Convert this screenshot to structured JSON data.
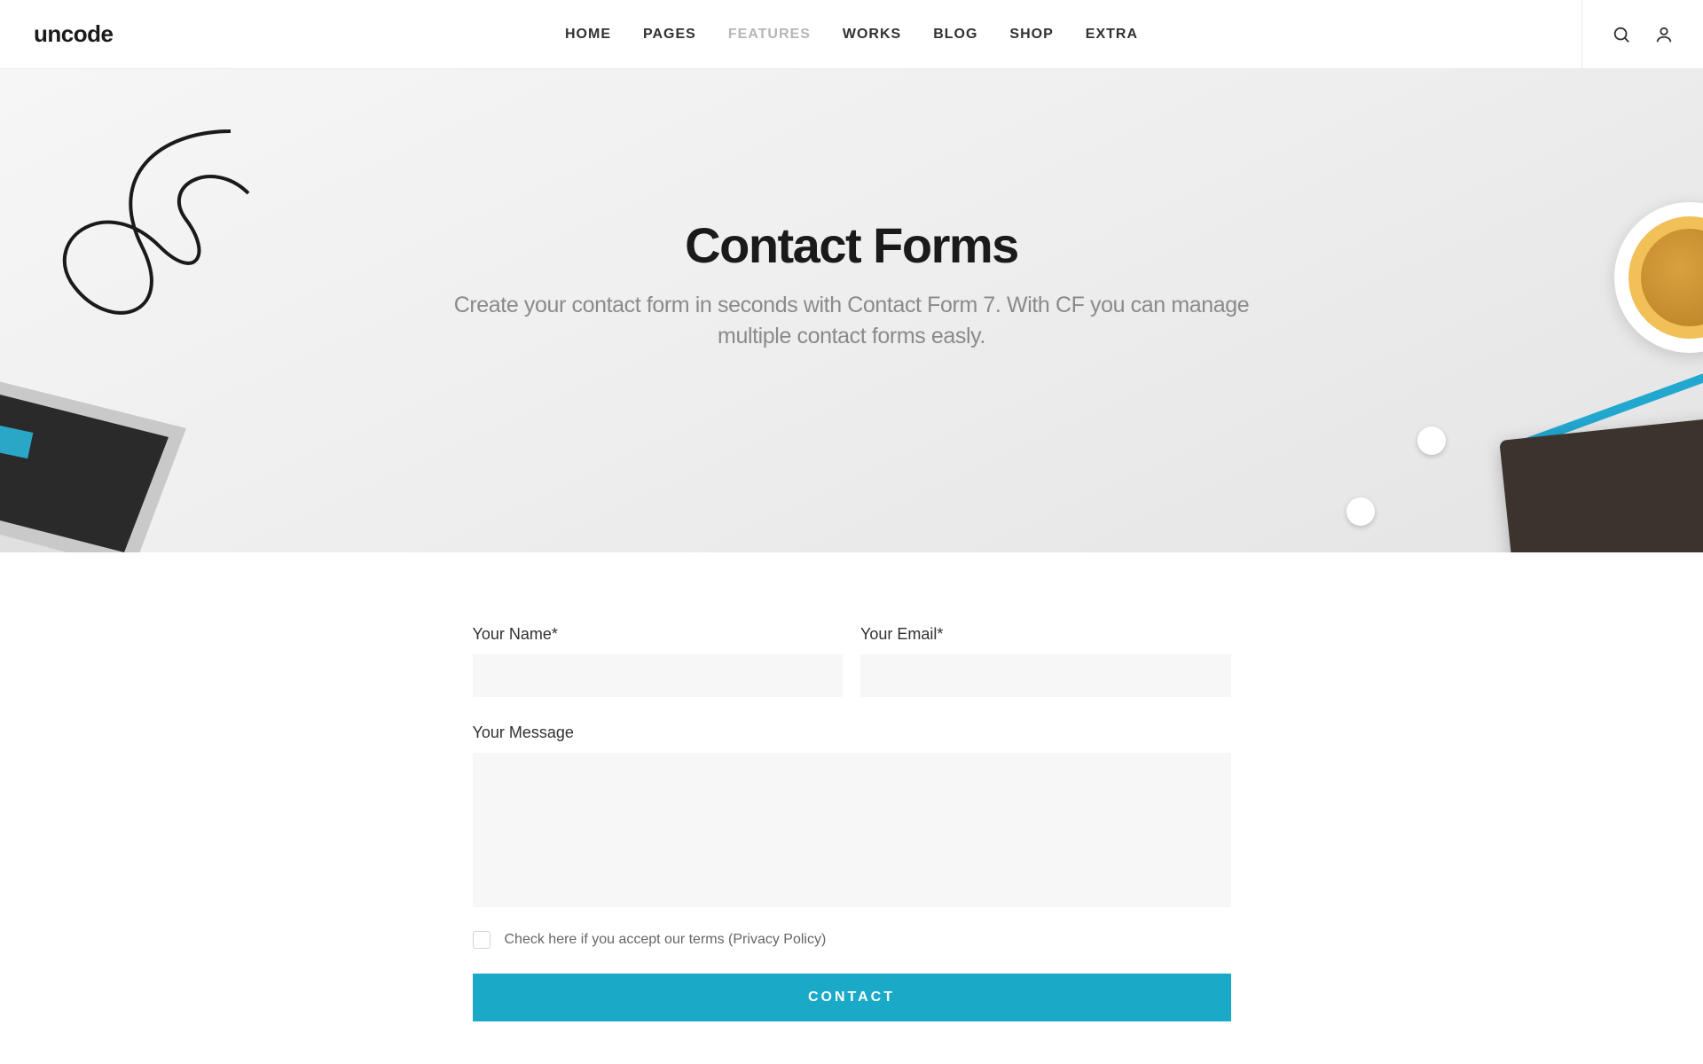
{
  "brand": "uncode",
  "nav": {
    "items": [
      {
        "label": "HOME",
        "active": false
      },
      {
        "label": "PAGES",
        "active": false
      },
      {
        "label": "FEATURES",
        "active": true
      },
      {
        "label": "WORKS",
        "active": false
      },
      {
        "label": "BLOG",
        "active": false
      },
      {
        "label": "SHOP",
        "active": false
      },
      {
        "label": "EXTRA",
        "active": false
      }
    ]
  },
  "hero": {
    "title": "Contact Forms",
    "subtitle": "Create your contact form in seconds with Contact Form 7. With CF you can manage multiple contact forms easly."
  },
  "form": {
    "name_label": "Your Name*",
    "email_label": "Your Email*",
    "message_label": "Your Message",
    "terms_text": "Check here if you accept our terms (Privacy Policy)",
    "submit_label": "CONTACT"
  }
}
